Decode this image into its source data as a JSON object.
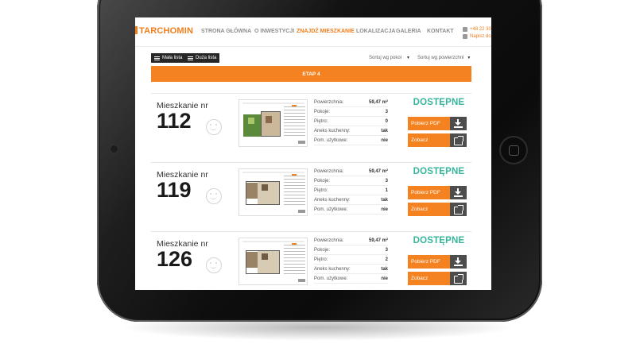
{
  "brand": {
    "logo_text": "TARCHOMIN",
    "accent": "#f58220",
    "status_color": "#36b59b"
  },
  "nav": {
    "items": [
      {
        "label": "STRONA GŁÓWNA"
      },
      {
        "label": "O INWESTYCJI"
      },
      {
        "label": "ZNAJDŹ MIESZKANIE",
        "active": true
      },
      {
        "label": "LOKALIZACJA"
      },
      {
        "label": "GALERIA"
      },
      {
        "label": "KONTAKT"
      }
    ],
    "contact": {
      "phone": "+48 22 30",
      "write": "Napisz do"
    }
  },
  "toolbar": {
    "small_list": "Mała lista",
    "large_list": "Duża lista",
    "sort_rooms": "Sortuj wg pokoi",
    "sort_area": "Sortuj wg powierzchni"
  },
  "stage": {
    "label": "ETAP 4"
  },
  "spec_labels": {
    "area": "Powierzchnia:",
    "rooms": "Pokoje:",
    "floor": "Piętro:",
    "kitchen": "Aneks kuchenny:",
    "utility": "Pom. użytkowe:"
  },
  "apartments": [
    {
      "label": "Mieszkanie nr",
      "number": "112",
      "area": "59,47  m²",
      "rooms": "3",
      "floor": "0",
      "kitchen": "tak",
      "utility": "nie",
      "status": "DOSTĘPNE",
      "pdf_label": "Pobierz PDF",
      "view_label": "Zobacz"
    },
    {
      "label": "Mieszkanie nr",
      "number": "119",
      "area": "59,47  m²",
      "rooms": "3",
      "floor": "1",
      "kitchen": "tak",
      "utility": "nie",
      "status": "DOSTĘPNE",
      "pdf_label": "Pobierz PDF",
      "view_label": "Zobacz"
    },
    {
      "label": "Mieszkanie nr",
      "number": "126",
      "area": "59,47  m²",
      "rooms": "3",
      "floor": "2",
      "kitchen": "tak",
      "utility": "nie",
      "status": "DOSTĘPNE",
      "pdf_label": "Pobierz PDF",
      "view_label": "Zobacz"
    }
  ]
}
